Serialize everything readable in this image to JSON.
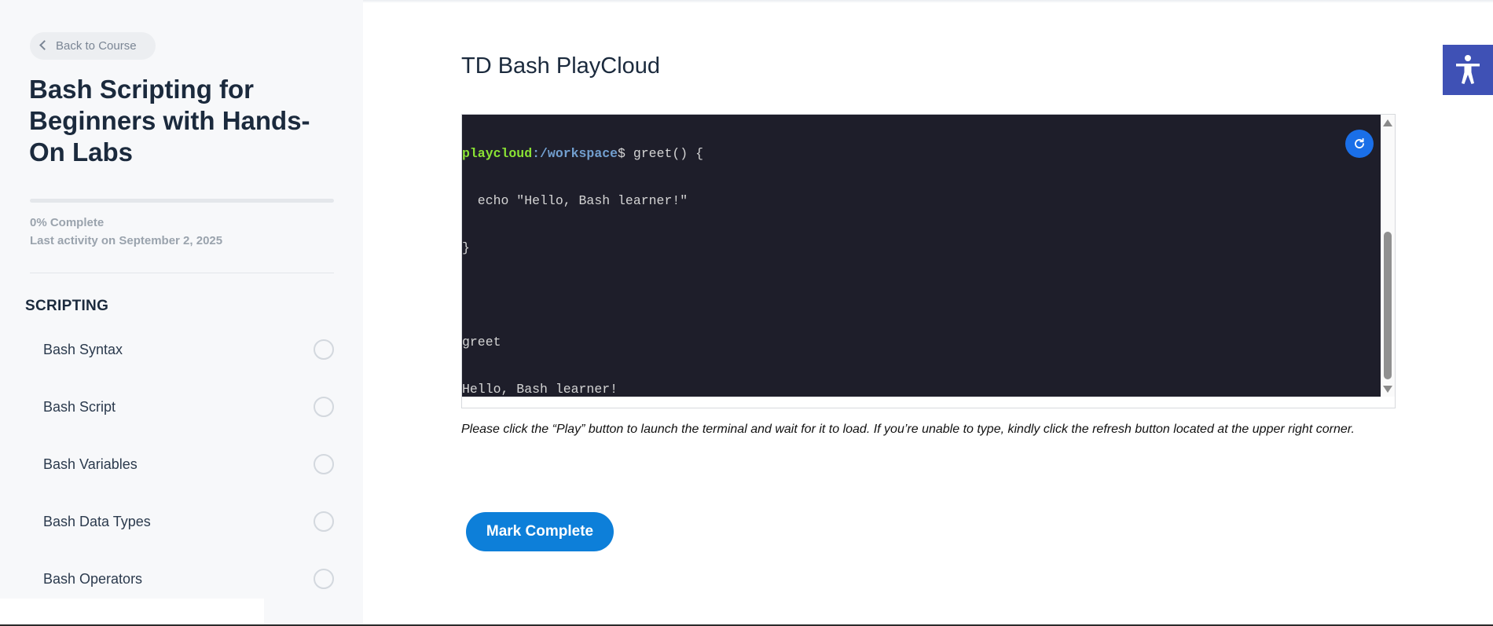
{
  "sidebar": {
    "back_label": "Back to Course",
    "course_title": "Bash Scripting for Beginners with Hands-On Labs",
    "progress": {
      "percent": 0,
      "label": "0% Complete"
    },
    "last_activity": "Last activity on September 2, 2025",
    "section_title": "SCRIPTING",
    "lessons": [
      {
        "label": "Bash Syntax"
      },
      {
        "label": "Bash Script"
      },
      {
        "label": "Bash Variables"
      },
      {
        "label": "Bash Data Types"
      },
      {
        "label": "Bash Operators"
      }
    ]
  },
  "main": {
    "page_title": "TD Bash PlayCloud",
    "terminal": {
      "prompt_user": "playcloud",
      "prompt_path": ":/workspace",
      "prompt_symbol": "$ ",
      "command_1": "greet() {",
      "line_2": "  echo \"Hello, Bash learner!\"",
      "line_3": "}",
      "line_4": "",
      "line_5": "greet",
      "line_6": "Hello, Bash learner!"
    },
    "hint": "Please click the “Play” button to launch the terminal and wait for it to load. If you’re unable to type, kindly click the refresh button located at the upper right corner.",
    "mark_complete_label": "Mark Complete"
  },
  "icons": {
    "back": "chevron-left-icon",
    "refresh": "refresh-icon",
    "accessibility": "accessibility-icon",
    "lesson_status": "empty-circle-icon"
  },
  "colors": {
    "accent": "#0d7fd9",
    "refresh_button": "#1a6fe8",
    "accessibility_button": "#3f51b5",
    "terminal_bg": "#1e1e2a",
    "prompt_user": "#8ae234",
    "prompt_path": "#729fcf"
  }
}
